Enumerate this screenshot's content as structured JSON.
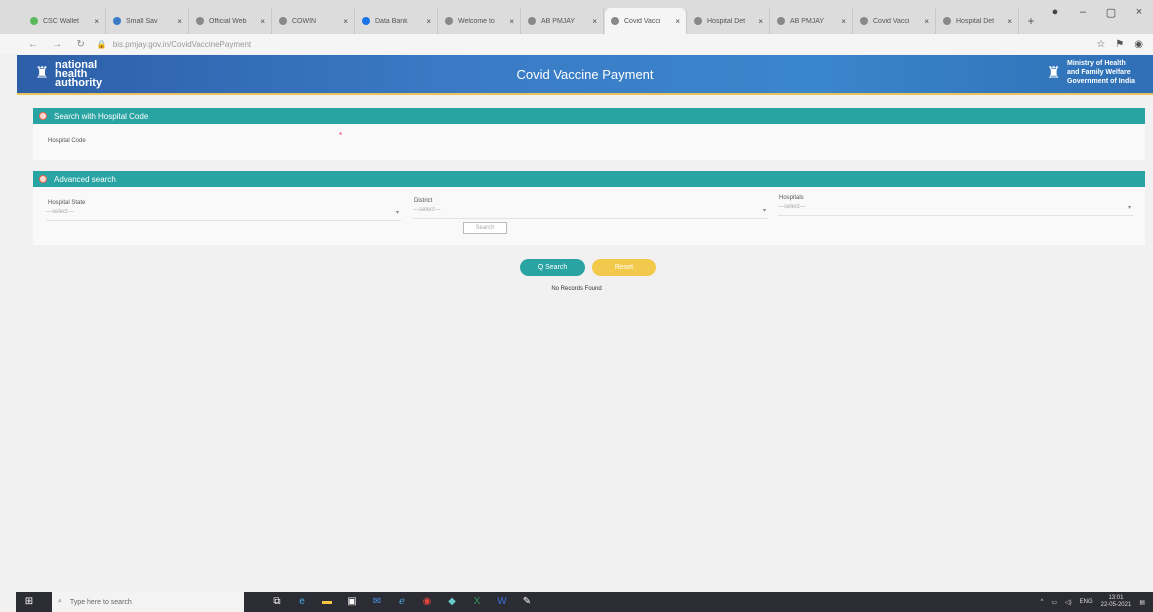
{
  "browser": {
    "tabs": [
      {
        "label": "CSC Wallet",
        "color": "#5cb85c"
      },
      {
        "label": "Small Sav",
        "color": "#3b7bc6"
      },
      {
        "label": "Official Web",
        "color": "#888888"
      },
      {
        "label": "COWIN",
        "color": "#888888"
      },
      {
        "label": "Data Bank",
        "color": "#1a73e8"
      },
      {
        "label": "Welcome to",
        "color": "#888888"
      },
      {
        "label": "AB PMJAY",
        "color": "#888888"
      },
      {
        "label": "Covid Vacci",
        "color": "#888888"
      },
      {
        "label": "Hospital Det",
        "color": "#888888"
      },
      {
        "label": "AB PMJAY",
        "color": "#888888"
      },
      {
        "label": "Covid Vacci",
        "color": "#888888"
      },
      {
        "label": "Hospital Det",
        "color": "#888888"
      }
    ],
    "url": "bis.pmjay.gov.in/CovidVaccinePayment"
  },
  "header": {
    "logo_line1": "national",
    "logo_line2": "health",
    "logo_line3": "authority",
    "title": "Covid Vaccine Payment",
    "ministry_line1": "Ministry of Health",
    "ministry_line2": "and Family Welfare",
    "ministry_line3": "Government of India"
  },
  "panels": {
    "hospital_code": {
      "heading": "Search with Hospital Code",
      "label": "Hospital Code"
    },
    "advanced": {
      "heading": "Advanced search",
      "state_label": "Hospital State",
      "state_value": "---select---",
      "district_label": "District",
      "district_value": "---select---",
      "hospitals_label": "Hospitals",
      "hospitals_value": "---select---",
      "mini_button": "Search"
    }
  },
  "actions": {
    "search_label": "Q Search",
    "reset_label": "Reset",
    "no_records": "No Records Found"
  },
  "taskbar": {
    "search_placeholder": "Type here to search",
    "lang": "ENG",
    "time": "13:01",
    "date": "22-05-2021"
  },
  "colors": {
    "header_blue": "#3b7bc6",
    "teal": "#2aa3a3",
    "reset_yellow": "#f2c94c"
  }
}
